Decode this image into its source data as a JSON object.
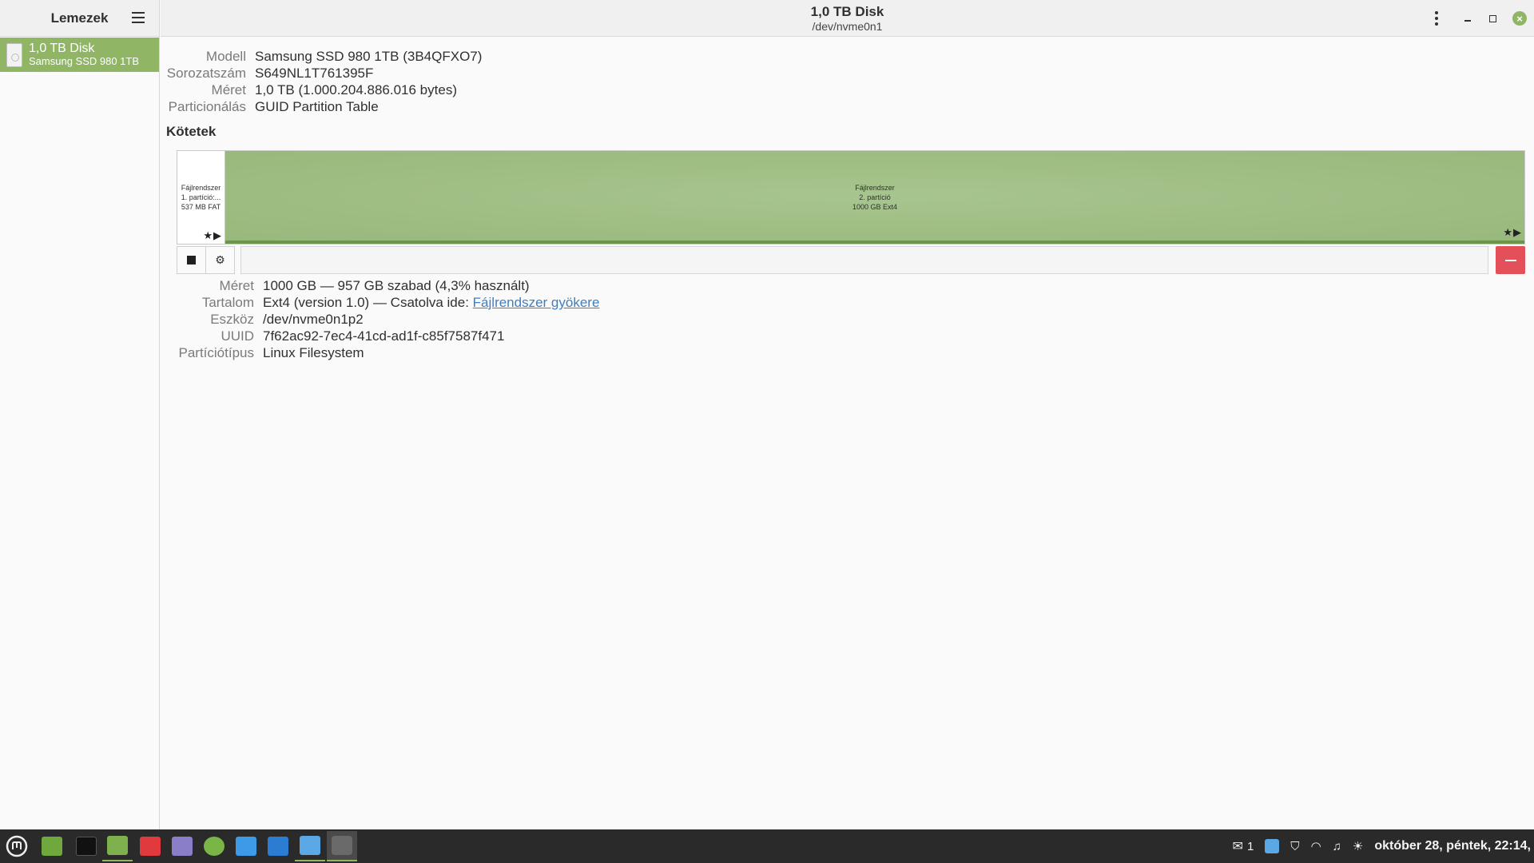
{
  "sidebar": {
    "title": "Lemezek",
    "disk": {
      "name": "1,0 TB Disk",
      "subtitle": "Samsung SSD 980 1TB"
    }
  },
  "header": {
    "title": "1,0 TB Disk",
    "subtitle": "/dev/nvme0n1",
    "close_glyph": "×"
  },
  "drive_info": [
    {
      "label": "Modell",
      "value": "Samsung SSD 980 1TB (3B4QFXO7)"
    },
    {
      "label": "Sorozatszám",
      "value": "S649NL1T761395F"
    },
    {
      "label": "Méret",
      "value": "1,0 TB (1.000.204.886.016 bytes)"
    },
    {
      "label": "Particionálás",
      "value": "GUID Partition Table"
    }
  ],
  "volumes_heading": "Kötetek",
  "partitions": [
    {
      "line1": "Fájlrendszer",
      "line2": "1. partíció:...",
      "line3": "537 MB FAT",
      "marks": "★▶",
      "selected": false
    },
    {
      "line1": "Fájlrendszer",
      "line2": "2. partíció",
      "line3": "1000 GB Ext4",
      "marks": "★▶",
      "selected": true
    }
  ],
  "toolbar": {
    "gear_glyph": "⚙"
  },
  "volume_info": [
    {
      "label": "Méret",
      "value": "1000 GB — 957 GB szabad (4,3% használt)"
    },
    {
      "label": "Tartalom",
      "value": "Ext4 (version 1.0) — Csatolva ide: ",
      "link": "Fájlrendszer gyökere"
    },
    {
      "label": "Eszköz",
      "value": "/dev/nvme0n1p2"
    },
    {
      "label": "UUID",
      "value": "7f62ac92-7ec4-41cd-ad1f-c85f7587f471"
    },
    {
      "label": "Partíciótípus",
      "value": "Linux Filesystem"
    }
  ],
  "taskbar": {
    "apps": [
      {
        "name": "mint-menu-icon",
        "color": "#2a2a2a"
      },
      {
        "name": "show-desktop-icon",
        "color": "#6fa83c"
      },
      {
        "name": "terminal-icon",
        "color": "#1a1a1a"
      },
      {
        "name": "files-icon",
        "color": "#7eb04e"
      },
      {
        "name": "vivaldi-icon",
        "color": "#e03a3e"
      },
      {
        "name": "text-editor-icon",
        "color": "#8a7ec8"
      },
      {
        "name": "software-manager-icon",
        "color": "#7ab548"
      },
      {
        "name": "workspace-icon",
        "color": "#3d9ae8"
      },
      {
        "name": "document-icon",
        "color": "#2b7cd3"
      },
      {
        "name": "update-manager-icon",
        "color": "#5aa9e6"
      },
      {
        "name": "disks-icon",
        "color": "#6a6a6a"
      }
    ],
    "tray": {
      "mail_count": "1",
      "clock": "október 28, péntek, 22:14,"
    }
  }
}
